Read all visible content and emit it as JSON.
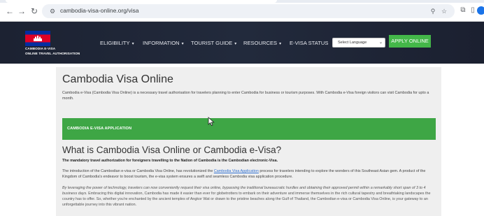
{
  "browser": {
    "url": "cambodia-visa-online.org/visa",
    "icons": [
      "back-icon",
      "forward-icon",
      "reload-icon",
      "site-info-icon",
      "zoom-icon",
      "star-icon",
      "extensions-icon",
      "sidebar-icon"
    ]
  },
  "site": {
    "brand_line1": "CAMBODIA E-VISA",
    "brand_line2": "ONLINE TRAVEL AUTHORISATION",
    "nav": [
      {
        "label": "ELIGIBILITY",
        "caret": "▾"
      },
      {
        "label": "INFORMATION",
        "caret": "▾"
      },
      {
        "label": "TOURIST GUIDE",
        "caret": "▾"
      },
      {
        "label": "RESOURCES",
        "caret": "▾"
      },
      {
        "label": "E-VISA STATUS",
        "caret": ""
      }
    ],
    "language_select": {
      "value": "Select Language"
    },
    "apply_label": "APPLY ONLINE",
    "colors": {
      "header": "#1a1f2e",
      "green": "#3ea645",
      "flag_blue": "#032ea1",
      "flag_red": "#e00025"
    }
  },
  "main": {
    "title": "Cambodia Visa Online",
    "intro": "Cambodia e-Visa (Cambodia Visa Online) is a necessary travel authorisation for travelers planning to enter Cambodia for business or tourism purposes. With Cambodia e-Visa foreign visitors can visit Cambodia for upto a month.",
    "application_bar": "CAMBODIA E-VISA APPLICATION",
    "h2": "What is Cambodia Visa Online or Cambodia e-Visa?",
    "subtitle": "The mandatory travel authorization for foreigners travelling to the Nation of Cambodia is the Cambodian electronic-Visa.",
    "p1_before": "The introduction of the Cambodian e-visa or Cambodia Visa Online, has revolutionized the ",
    "p1_link": "Cambodia Visa Application",
    "p1_after": " process for travelers intending to explore the wonders of this Southeast Asian gem. A product of the Kingdom of Cambodia's endeavor to boost tourism, the e-visa system ensures a swift and seamless Cambodia visa application procedure.",
    "p2_italic": "By leveraging the power of technology, travelers can now conveniently request their visa online, bypassing the traditional bureaucratic hurdles and obtaining their approved permit within a remarkably short span of 3 to 4 business days.",
    "p2_normal": " Embracing this digital innovation, Cambodia has made it easier than ever for globetrotters to embark on their adventure and immerse themselves in the rich cultural tapestry and breathtaking landscapes the country has to offer. So, whether you're enchanted by the ancient temples of Angkor Wat or drawn to the pristine beaches along the Gulf of Thailand, the Cambodian e-visa or Cambodia Visa Online, is your gateway to an unforgettable journey into this vibrant nation."
  }
}
